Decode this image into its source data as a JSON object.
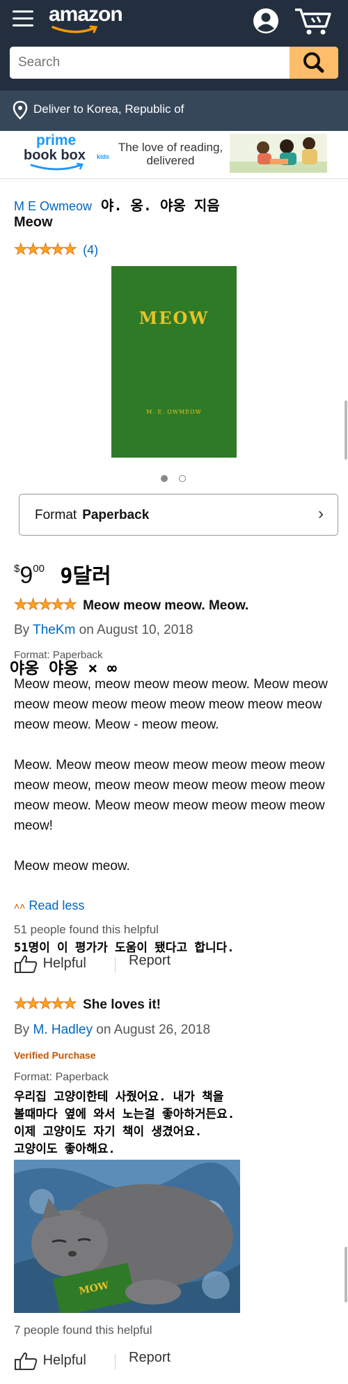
{
  "header": {
    "logo": "amazon",
    "search_placeholder": "Search",
    "deliver_text": "Deliver to Korea, Republic of"
  },
  "banner": {
    "prime": "prime",
    "bookbox": "book box",
    "kids": "kids",
    "tagline": "The love of reading, delivered"
  },
  "product": {
    "author_link": "M E Owmeow",
    "author_note": "야. 옹. 야옹 지음",
    "title": "Meow",
    "rating_count": "(4)",
    "rating_stars": 5,
    "cover_title": "MEOW",
    "cover_author": "M. E. OWMEOW",
    "format_label": "Format",
    "format_value": "Paperback",
    "price_symbol": "$",
    "price_whole": "9",
    "price_fraction": "00",
    "price_note": "9달러"
  },
  "reviews": [
    {
      "stars": 5,
      "headline": "Meow meow meow. Meow.",
      "by": "By",
      "author": "TheKm",
      "date": "on August 10, 2018",
      "format": "Format: Paperback",
      "overlay_note": "야옹 야옹 × ∞",
      "paragraphs": [
        "Meow meow, meow meow meow meow. Meow meow meow meow meow meow meow meow meow meow meow meow. Meow - meow meow.",
        "Meow. Meow meow meow meow meow meow meow meow meow, meow meow meow meow meow meow meow meow. Meow meow meow meow meow meow meow!",
        "Meow meow meow."
      ],
      "read_less": "Read less",
      "helpful_count": "51 people found this helpful",
      "helpful_note": "51명이 이 평가가 도움이 됐다고 합니다.",
      "helpful_btn": "Helpful",
      "report_btn": "Report"
    },
    {
      "stars": 5,
      "headline": "She loves it!",
      "by": "By",
      "author": "M. Hadley",
      "date": "on August 26, 2018",
      "verified": "Verified Purchase",
      "format": "Format: Paperback",
      "note_lines": [
        "우리집 고양이한테 사줬어요. 내가 책을",
        "볼때마다 옆에 와서 노는걸 좋아하거든요.",
        "이제 고양이도 자기 책이 생겼어요.",
        "고양이도 좋아해요."
      ],
      "photo_book_text": "MOW",
      "helpful_count": "7 people found this helpful",
      "helpful_btn": "Helpful",
      "report_btn": "Report"
    }
  ]
}
